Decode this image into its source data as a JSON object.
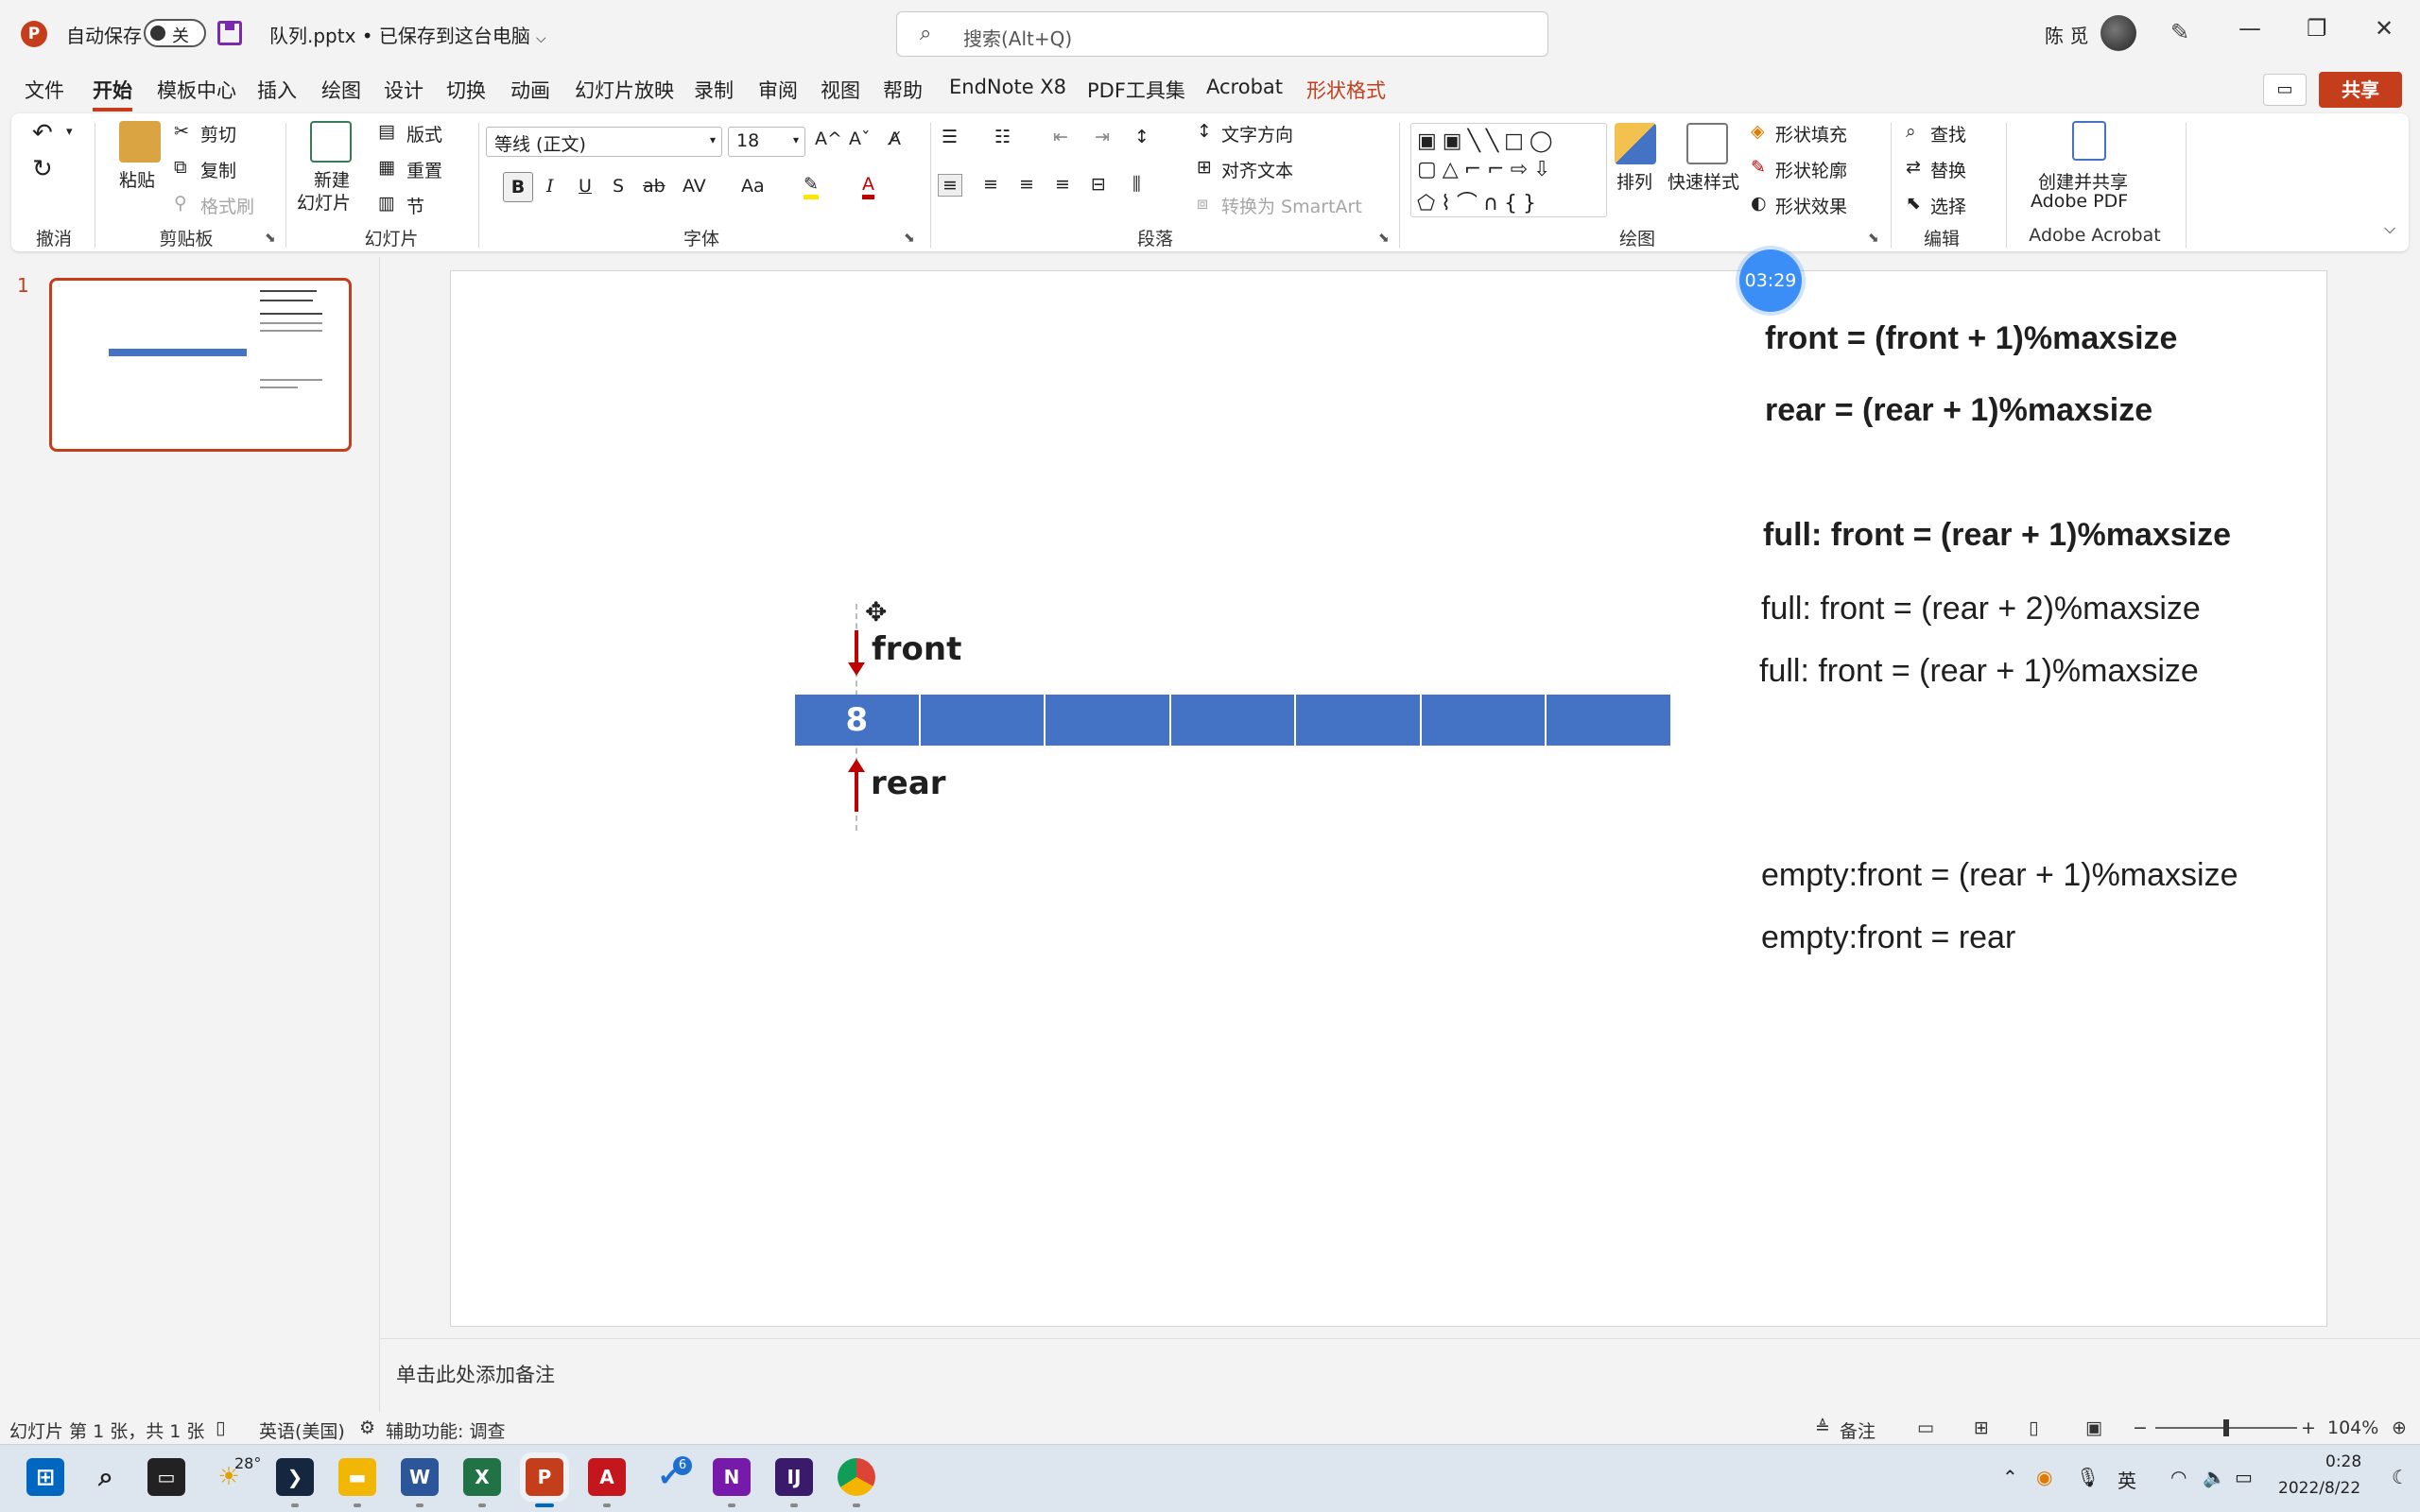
{
  "titlebar": {
    "logo_letter": "P",
    "autosave_label": "自动保存",
    "autosave_state": "关",
    "doc_title": "队列.pptx • 已保存到这台电脑",
    "search_placeholder": "搜索(Alt+Q)",
    "user_name": "陈 觅",
    "minimize": "—",
    "restore": "❐",
    "close": "✕"
  },
  "menu": {
    "tabs": [
      "文件",
      "开始",
      "模板中心",
      "插入",
      "绘图",
      "设计",
      "切换",
      "动画",
      "幻灯片放映",
      "录制",
      "审阅",
      "视图",
      "帮助",
      "EndNote X8",
      "PDF工具集",
      "Acrobat",
      "形状格式"
    ],
    "active_tab": "开始",
    "share": "共享"
  },
  "ribbon": {
    "groups": {
      "undo": "撤消",
      "clipboard": "剪贴板",
      "slides": "幻灯片",
      "font": "字体",
      "paragraph": "段落",
      "drawing": "绘图",
      "editing": "编辑",
      "acrobat": "Adobe Acrobat"
    },
    "paste": "粘贴",
    "cut": "剪切",
    "copy": "复制",
    "format_painter": "格式刷",
    "new_slide_1": "新建",
    "new_slide_2": "幻灯片",
    "layout": "版式",
    "reset": "重置",
    "section": "节",
    "font_name": "等线 (正文)",
    "font_size": "18",
    "bold": "B",
    "italic": "I",
    "underline": "U",
    "shadow": "S",
    "strike": "ab",
    "spacing": "AV",
    "case": "Aa",
    "grow": "A^",
    "shrink": "Aˇ",
    "text_direction": "文字方向",
    "align_text": "对齐文本",
    "smartart": "转换为 SmartArt",
    "arrange": "排列",
    "quick_styles": "快速样式",
    "shape_fill": "形状填充",
    "shape_outline": "形状轮廓",
    "shape_effects": "形状效果",
    "find": "查找",
    "replace": "替换",
    "select": "选择",
    "create_pdf_1": "创建并共享",
    "create_pdf_2": "Adobe PDF"
  },
  "slide_panel": {
    "slide_number": "1"
  },
  "slide": {
    "queue_cells": [
      "8",
      "",
      "",
      "",
      "",
      "",
      ""
    ],
    "front_label": "front",
    "rear_label": "rear",
    "formulas": [
      "front = (front + 1)%maxsize",
      "rear = (rear + 1)%maxsize",
      "full: front = (rear + 1)%maxsize",
      "full: front = (rear + 2)%maxsize",
      "full: front = (rear + 1)%maxsize",
      "empty:front = (rear + 1)%maxsize",
      "empty:front = rear"
    ]
  },
  "timer": "03:29",
  "notes_placeholder": "单击此处添加备注",
  "status": {
    "slide_info": "幻灯片 第 1 张，共 1 张",
    "language": "英语(美国)",
    "accessibility": "辅助功能: 调查",
    "notes": "备注",
    "zoom": "104%"
  },
  "taskbar": {
    "weather": "28°",
    "badge": "6",
    "ime": "英",
    "time": "0:28",
    "date": "2022/8/22"
  },
  "colors": {
    "accent": "#c43e1c",
    "queue_fill": "#4472c4",
    "arrow": "#c00000",
    "timer": "#3a8ef6"
  }
}
